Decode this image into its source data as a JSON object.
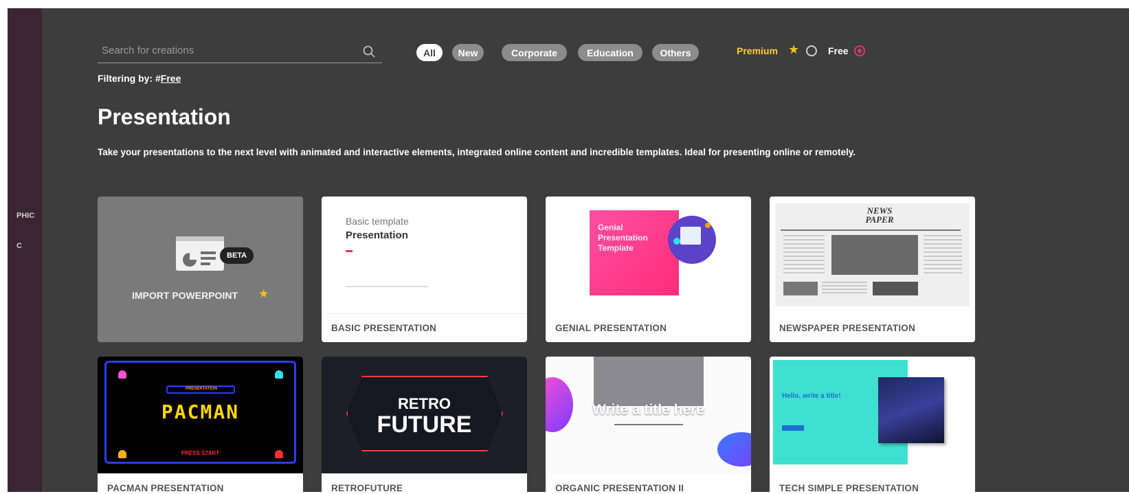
{
  "sidebar": {
    "items": [
      {
        "label": "PHIC"
      },
      {
        "label": "C"
      }
    ]
  },
  "search": {
    "placeholder": "Search for creations",
    "value": ""
  },
  "filters": {
    "chips": [
      {
        "label": "All",
        "active": true
      },
      {
        "label": "New",
        "active": false
      },
      {
        "label": "Corporate",
        "active": false
      },
      {
        "label": "Education",
        "active": false
      },
      {
        "label": "Others",
        "active": false
      }
    ],
    "premium_label": "Premium",
    "free_label": "Free",
    "selected": "Free"
  },
  "filtering": {
    "prefix": "Filtering by: #",
    "tag": "Free"
  },
  "section": {
    "title": "Presentation",
    "description": "Take your presentations to the next level with animated and interactive elements, integrated online content and incredible templates. Ideal for presenting online or remotely."
  },
  "cards": [
    {
      "label": "IMPORT POWERPOINT",
      "badge": "BETA",
      "premium": true
    },
    {
      "label": "BASIC PRESENTATION",
      "thumb_line1": "Basic template",
      "thumb_line2": "Presentation"
    },
    {
      "label": "GENIAL PRESENTATION",
      "thumb_text": "Genial Presentation Template"
    },
    {
      "label": "NEWSPAPER PRESENTATION",
      "thumb_text": "NEWS PAPER"
    },
    {
      "label": "PACMAN PRESENTATION",
      "thumb_text": "PACMAN",
      "thumb_small": "PRESENTATION",
      "thumb_press": "PRESS START"
    },
    {
      "label": "RETROFUTURE",
      "thumb_line1": "RETRO",
      "thumb_line2": "FUTURE"
    },
    {
      "label": "ORGANIC PRESENTATION II",
      "thumb_text": "Write a title here"
    },
    {
      "label": "TECH SIMPLE PRESENTATION",
      "thumb_text": "Hello, write a title!"
    }
  ],
  "colors": {
    "background": "#3d3d3d",
    "sidebar": "#3a2632",
    "accent": "#e0347a",
    "premium": "#ffcc3d"
  }
}
